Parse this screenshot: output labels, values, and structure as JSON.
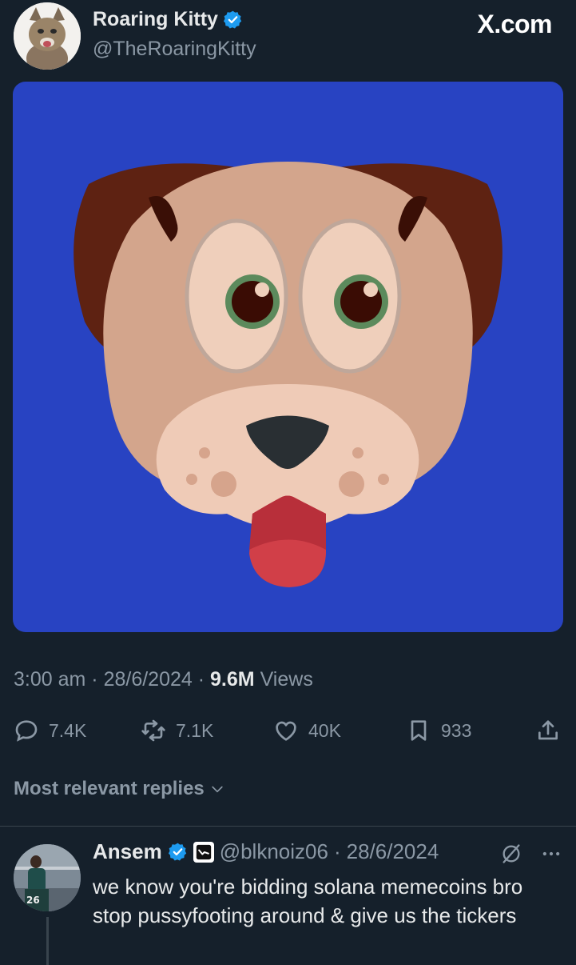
{
  "header": {
    "name": "Roaring Kitty",
    "handle": "@TheRoaringKitty",
    "site": "X.com"
  },
  "meta": {
    "time": "3:00 am",
    "date": "28/6/2024",
    "views_count": "9.6M",
    "views_label": "Views"
  },
  "actions": {
    "replies": "7.4K",
    "reposts": "7.1K",
    "likes": "40K",
    "bookmarks": "933"
  },
  "replies_sort": {
    "label": "Most relevant replies"
  },
  "reply": {
    "name": "Ansem",
    "handle": "@blknoiz06",
    "date": "28/6/2024",
    "text": "we know you're bidding solana memecoins bro stop pussyfooting around & give us the tickers"
  },
  "colors": {
    "background": "#15202b",
    "verified": "#1d9bf0",
    "image_background": "#2843c2"
  }
}
